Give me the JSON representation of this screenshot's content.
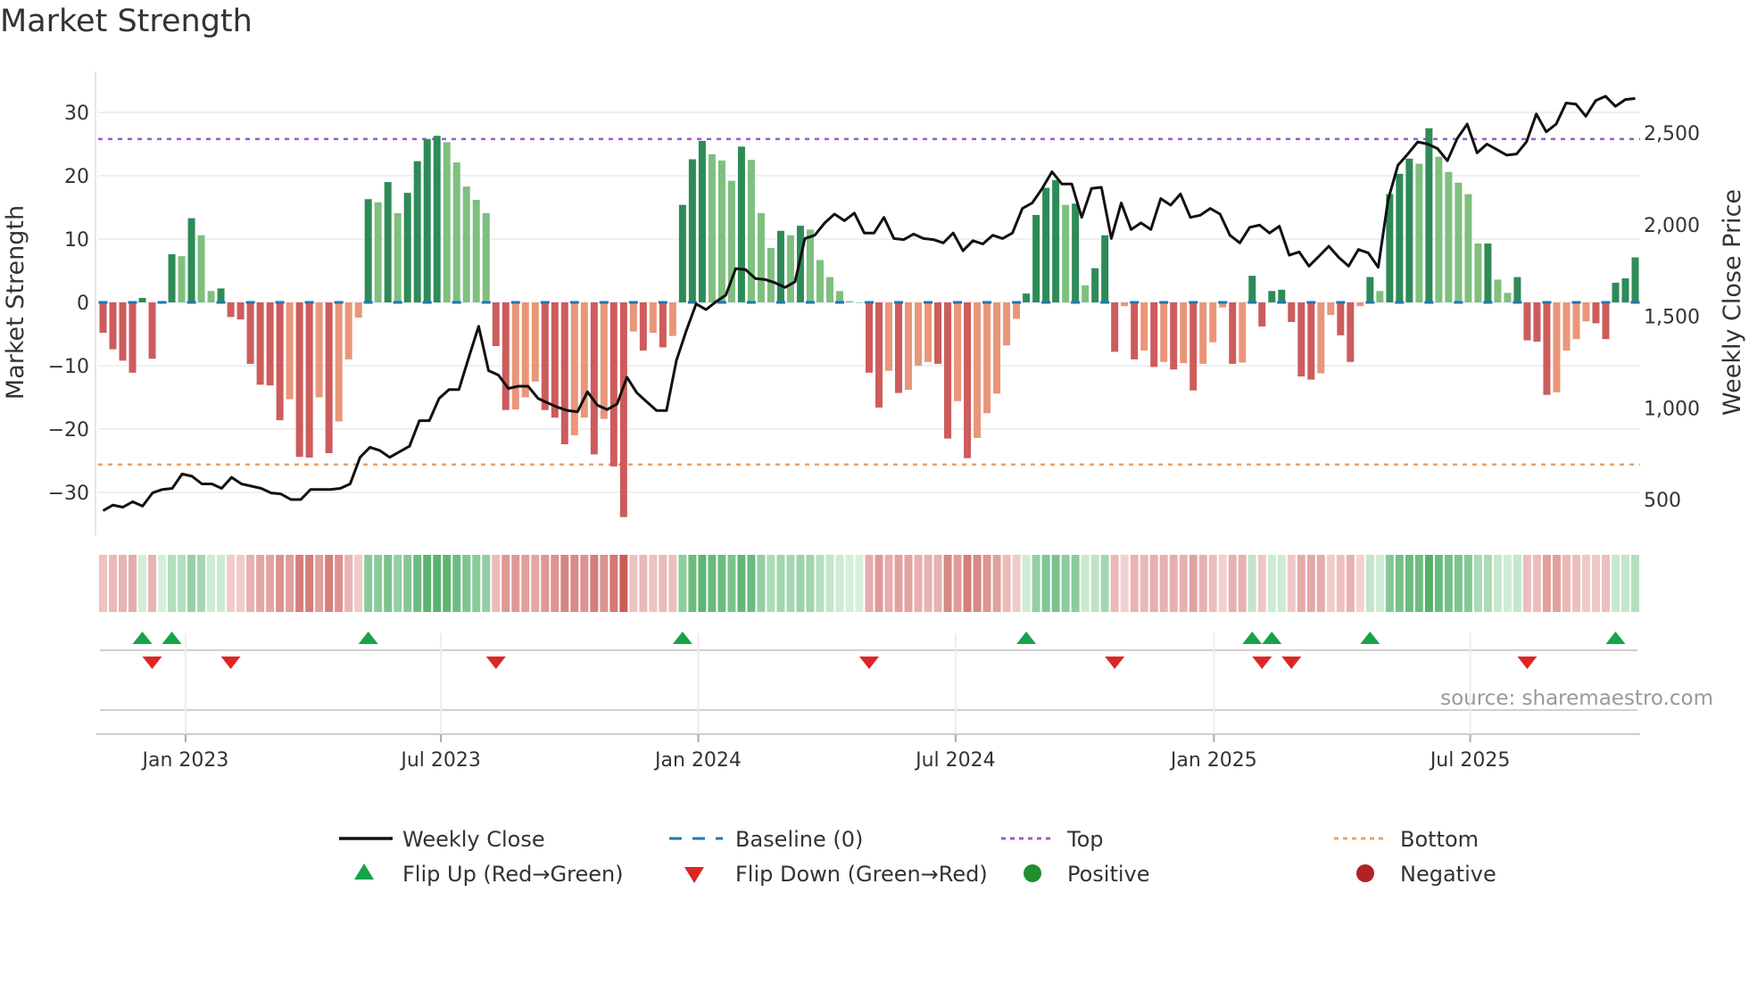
{
  "title": "Market Strength",
  "source": "source: sharemaestro.com",
  "colors": {
    "rising_positive": "#2e8b57",
    "falling_positive": "#7fbf7f",
    "falling_negative": "#cd5c5c",
    "rising_negative": "#e9967a",
    "price_line": "#111111",
    "baseline": "#1f77b4",
    "top": "#9b59d6",
    "bottom": "#f0a060",
    "flip_up": "#17a34a",
    "flip_down": "#dc2626",
    "positive": "#1f8f2f",
    "negative": "#b22222"
  },
  "chart_data": {
    "type": "bar+line",
    "title": "Market Strength",
    "ylabel": "Market Strength",
    "y2label": "Weekly Close Price",
    "ylim": [
      -36,
      36
    ],
    "y2lim": [
      300,
      2800
    ],
    "yticks": [
      -30,
      -20,
      -10,
      0,
      10,
      20,
      30
    ],
    "ytick_labels": [
      "−30",
      "−20",
      "−10",
      "0",
      "10",
      "20",
      "30"
    ],
    "y2ticks": [
      500,
      1000,
      1500,
      2000,
      2500
    ],
    "y2tick_labels": [
      "500",
      "1,000",
      "1,500",
      "2,000",
      "2,500"
    ],
    "xticks": [
      {
        "week": 8.9,
        "label": "Jan 2023"
      },
      {
        "week": 34.9,
        "label": "Jul 2023"
      },
      {
        "week": 61.1,
        "label": "Jan 2024"
      },
      {
        "week": 87.3,
        "label": "Jul 2024"
      },
      {
        "week": 113.6,
        "label": "Jan 2025"
      },
      {
        "week": 139.7,
        "label": "Jul 2025"
      }
    ],
    "top_level": 25.8,
    "bottom_level": -25.6,
    "baseline": 0,
    "strength": [
      -4.8,
      -7.4,
      -9.2,
      -11.1,
      0.7,
      -8.9,
      0,
      7.6,
      7.3,
      13.3,
      10.6,
      1.8,
      2.2,
      -2.3,
      -2.7,
      -9.7,
      -13,
      -13.1,
      -18.6,
      -15.3,
      -24.4,
      -24.5,
      -15,
      -23.8,
      -18.8,
      -9,
      -2.4,
      16.3,
      15.8,
      19,
      14.1,
      17.3,
      22.3,
      25.8,
      26.3,
      25.3,
      22.1,
      18.3,
      16.2,
      14.1,
      -6.9,
      -17,
      -16.9,
      -15,
      -12.5,
      -17,
      -18.2,
      -22.4,
      -21,
      -18.2,
      -24,
      -18.4,
      -25.9,
      -33.9,
      -4.6,
      -7.6,
      -4.8,
      -7.1,
      -5.3,
      15.4,
      22.6,
      25.5,
      23.4,
      22.4,
      19.2,
      24.6,
      22.5,
      14.1,
      8.6,
      11.3,
      10.6,
      12.1,
      11.5,
      6.7,
      4,
      1.8,
      0.2,
      0,
      -11.1,
      -16.6,
      -10.8,
      -14.3,
      -13.8,
      -10,
      -9.4,
      -9.7,
      -21.5,
      -15.6,
      -24.6,
      -21.4,
      -17.5,
      -14.4,
      -6.8,
      -2.6,
      1.4,
      13.8,
      18.1,
      19.3,
      15.4,
      15.6,
      2.7,
      5.4,
      10.6,
      -7.8,
      -0.6,
      -9,
      -7.6,
      -10.2,
      -9.4,
      -10.6,
      -9.6,
      -13.9,
      -9.7,
      -6.3,
      -0.8,
      -9.7,
      -9.5,
      4.2,
      -3.8,
      1.8,
      2.0,
      -3.1,
      -11.7,
      -12.2,
      -11.2,
      -2,
      -5.2,
      -9.4,
      -0.6,
      4,
      1.8,
      17.1,
      20.3,
      22.7,
      21.9,
      27.5,
      23,
      20.6,
      18.9,
      17.1,
      9.3,
      9.3,
      3.6,
      1.5,
      4,
      -6,
      -6.2,
      -14.6,
      -14.2,
      -7.6,
      -5.8,
      -3,
      -3.3,
      -5.8,
      3.1,
      3.8,
      7.1
    ],
    "weekly_close": [
      439,
      470,
      458,
      488,
      464,
      536,
      555,
      561,
      639,
      627,
      585,
      585,
      561,
      621,
      585,
      573,
      561,
      536,
      530,
      500,
      500,
      555,
      555,
      555,
      561,
      585,
      730,
      785,
      767,
      730,
      761,
      791,
      930,
      930,
      1052,
      1100,
      1100,
      1276,
      1445,
      1203,
      1179,
      1106,
      1118,
      1118,
      1052,
      1027,
      1003,
      985,
      979,
      1088,
      1015,
      991,
      1021,
      1167,
      1082,
      1033,
      985,
      985,
      1258,
      1421,
      1567,
      1536,
      1579,
      1615,
      1760,
      1754,
      1706,
      1700,
      1682,
      1657,
      1688,
      1924,
      1942,
      2009,
      2057,
      2021,
      2063,
      1954,
      1954,
      2039,
      1924,
      1918,
      1948,
      1924,
      1918,
      1900,
      1954,
      1857,
      1912,
      1894,
      1942,
      1924,
      1954,
      2088,
      2118,
      2197,
      2288,
      2221,
      2221,
      2039,
      2197,
      2203,
      1924,
      2118,
      1973,
      2009,
      1973,
      2142,
      2106,
      2167,
      2039,
      2051,
      2088,
      2057,
      1942,
      1900,
      1985,
      1997,
      1954,
      1991,
      1833,
      1851,
      1773,
      1827,
      1882,
      1821,
      1773,
      1864,
      1845,
      1767,
      2136,
      2324,
      2385,
      2451,
      2439,
      2415,
      2348,
      2470,
      2548,
      2391,
      2439,
      2409,
      2379,
      2385,
      2451,
      2603,
      2506,
      2548,
      2663,
      2657,
      2591,
      2676,
      2700,
      2645,
      2682,
      2688
    ],
    "flip_up_weeks": [
      4,
      7,
      27,
      59,
      94,
      117,
      119,
      129,
      154
    ],
    "flip_down_weeks": [
      5,
      13,
      40,
      78,
      103,
      118,
      121,
      145
    ]
  },
  "legend": [
    {
      "key": "weekly_close",
      "label": "Weekly Close",
      "symbol": "line"
    },
    {
      "key": "baseline",
      "label": "Baseline (0)",
      "symbol": "dash"
    },
    {
      "key": "top",
      "label": "Top",
      "symbol": "dot"
    },
    {
      "key": "bottom",
      "label": "Bottom",
      "symbol": "dot"
    },
    {
      "key": "flip_up",
      "label": "Flip Up (Red→Green)",
      "symbol": "tri-up"
    },
    {
      "key": "flip_down",
      "label": "Flip Down (Green→Red)",
      "symbol": "tri-down"
    },
    {
      "key": "positive",
      "label": "Positive",
      "symbol": "circle"
    },
    {
      "key": "negative",
      "label": "Negative",
      "symbol": "circle"
    }
  ]
}
